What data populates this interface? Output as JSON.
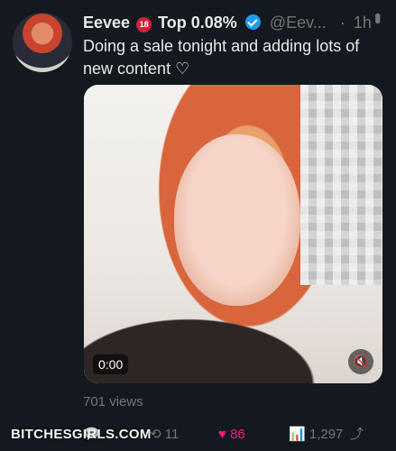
{
  "tweet": {
    "display_name": "Eevee",
    "age_badge": "18",
    "rank_text": "Top 0.08%",
    "handle": "@Eev...",
    "separator": "·",
    "time": "1h",
    "text": "Doing a sale tonight and adding lots of new content ♡"
  },
  "media": {
    "duration": "0:00",
    "mute_icon": "speaker-mute-icon"
  },
  "stats": {
    "views_text": "701 views",
    "retweets": "11",
    "likes": "86",
    "views": "1,297"
  },
  "watermark": "BITCHESGIRLS.COM",
  "colors": {
    "background": "#14191f",
    "verified": "#1d9bf0",
    "like": "#f91880",
    "age_badge": "#d21f3c",
    "muted": "#71767b"
  }
}
